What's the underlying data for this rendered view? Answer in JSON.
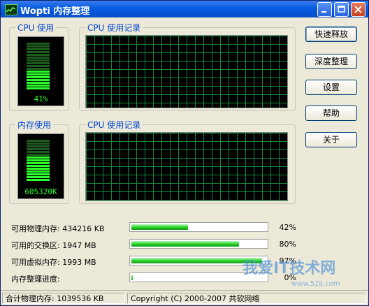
{
  "window": {
    "title": "Wopti 内存整理"
  },
  "panels": {
    "cpu_usage": {
      "legend": "CPU 使用",
      "value": "41%",
      "fill_fraction": 0.41
    },
    "cpu_history_top": {
      "legend": "CPU 使用记录"
    },
    "mem_usage": {
      "legend": "内存使用",
      "value": "605320K",
      "fill_fraction": 0.6
    },
    "cpu_history_bottom": {
      "legend": "CPU 使用记录"
    }
  },
  "buttons": {
    "quick_release": "快速释放",
    "deep_clean": "深度整理",
    "settings": "设置",
    "help": "帮助",
    "about": "关于"
  },
  "stats": [
    {
      "label": "可用物理内存: 434216 KB",
      "percent": "42%",
      "fraction": 0.42
    },
    {
      "label": "可用的交换区: 1947 MB",
      "percent": "80%",
      "fraction": 0.8
    },
    {
      "label": "可用虚拟内存: 1993 MB",
      "percent": "97%",
      "fraction": 0.97
    },
    {
      "label": "内存整理进度:",
      "percent": "0%",
      "fraction": 0.0
    }
  ],
  "statusbar": {
    "total": "合计物理内存: 1039536 KB",
    "copyright": "Copyright (C) 2000-2007 共软网络"
  },
  "watermark": {
    "main": "我爱IT技术网",
    "sub": "www.52ij.com"
  },
  "colors": {
    "accent_blue": "#0046d5",
    "meter_green": "#2cff2c",
    "grid_green": "#0f8a3c"
  }
}
